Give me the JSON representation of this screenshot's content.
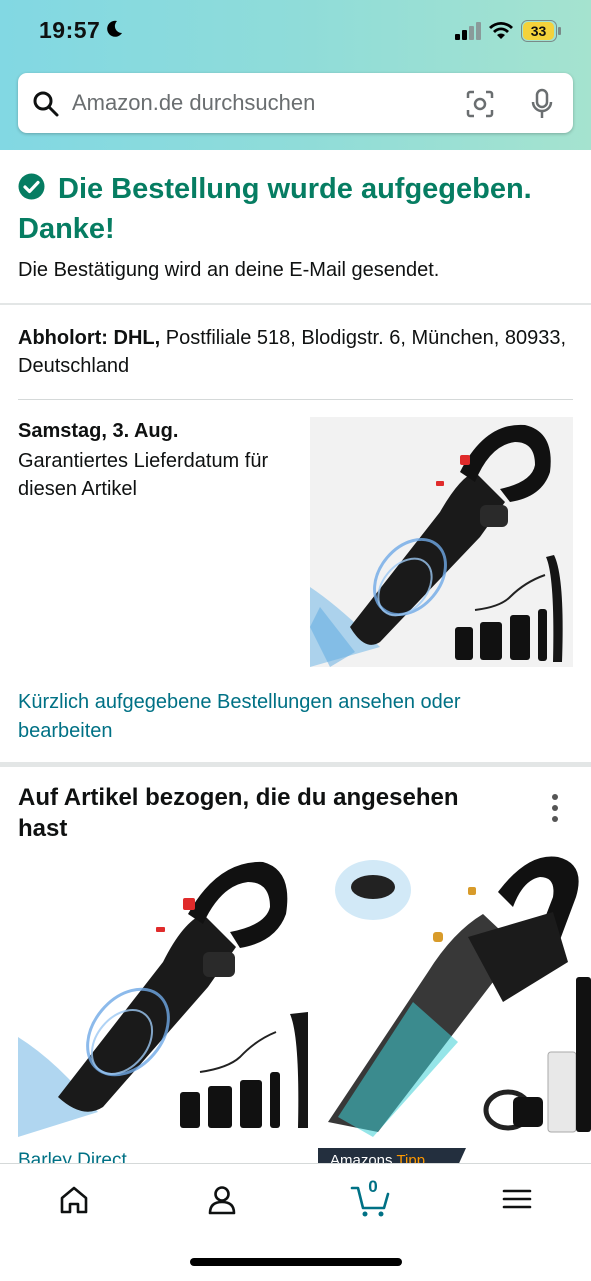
{
  "status_bar": {
    "time": "19:57",
    "battery": "33"
  },
  "search": {
    "placeholder": "Amazon.de durchsuchen"
  },
  "confirmation": {
    "title": "Die Bestellung wurde aufgegeben. Danke!",
    "subtitle": "Die Bestätigung wird an deine E-Mail gesendet."
  },
  "pickup": {
    "label": "Abholort: DHL,",
    "address": " Postfiliale 518, Blodigstr. 6, München, 80933, Deutschland"
  },
  "delivery": {
    "date": "Samstag, 3. Aug.",
    "note": "Garantiertes Lieferdatum für diesen Artikel"
  },
  "orders_link": "Kürzlich aufgegebene Bestellungen ansehen oder bearbeiten",
  "recommendations": {
    "title": "Auf Artikel bezogen, die du angesehen hast",
    "items": [
      {
        "brand": "Barley Direct"
      },
      {
        "badge_prefix": "Amazons ",
        "badge_accent": "Tipp"
      }
    ]
  },
  "tabbar": {
    "cart_count": "0"
  },
  "colors": {
    "accent_green": "#067d62",
    "link": "#007185",
    "header_gradient_start": "#82d8e3"
  }
}
